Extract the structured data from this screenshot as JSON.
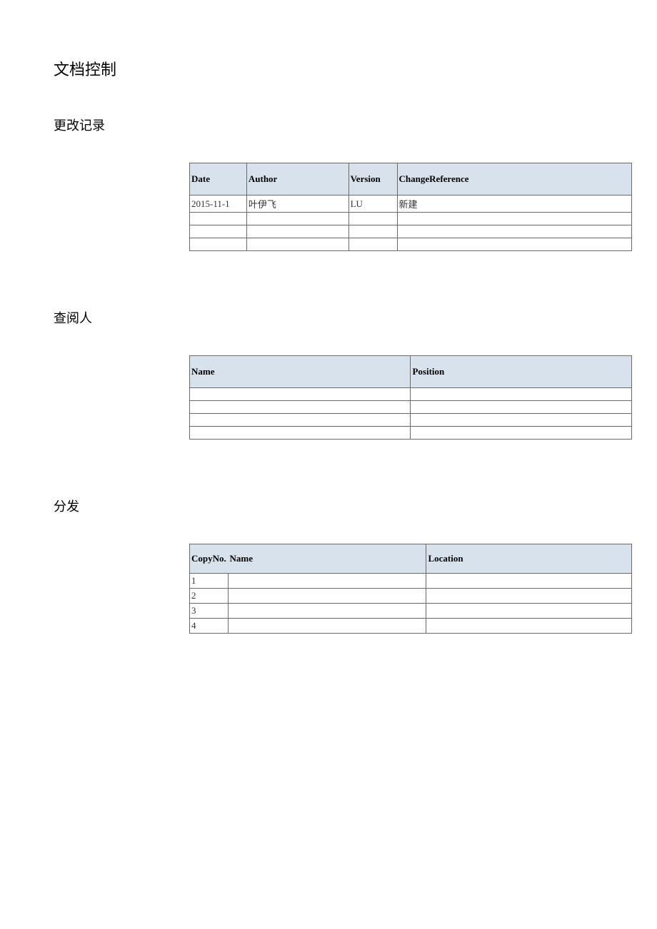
{
  "headings": {
    "doc_control": "文档控制",
    "change_log": "更改记录",
    "reviewers": "查阅人",
    "distribution": "分发"
  },
  "change_table": {
    "headers": {
      "date": "Date",
      "author": "Author",
      "version": "Version",
      "change_ref": "ChangeReference"
    },
    "rows": [
      {
        "date": "2015-11-1",
        "author": "叶伊飞",
        "version": "LU",
        "change_ref": "新建"
      },
      {
        "date": "",
        "author": "",
        "version": "",
        "change_ref": ""
      },
      {
        "date": "",
        "author": "",
        "version": "",
        "change_ref": ""
      },
      {
        "date": "",
        "author": "",
        "version": "",
        "change_ref": ""
      }
    ]
  },
  "review_table": {
    "headers": {
      "name": "Name",
      "position": "Position"
    },
    "rows": [
      {
        "name": "",
        "position": ""
      },
      {
        "name": "",
        "position": ""
      },
      {
        "name": "",
        "position": ""
      },
      {
        "name": "",
        "position": ""
      }
    ]
  },
  "dist_table": {
    "headers": {
      "copyno": "CopyNo.",
      "name": "Name",
      "location": "Location"
    },
    "rows": [
      {
        "copyno": "1",
        "name": "",
        "location": ""
      },
      {
        "copyno": "2",
        "name": "",
        "location": ""
      },
      {
        "copyno": "3",
        "name": "",
        "location": ""
      },
      {
        "copyno": "4",
        "name": "",
        "location": ""
      }
    ]
  }
}
